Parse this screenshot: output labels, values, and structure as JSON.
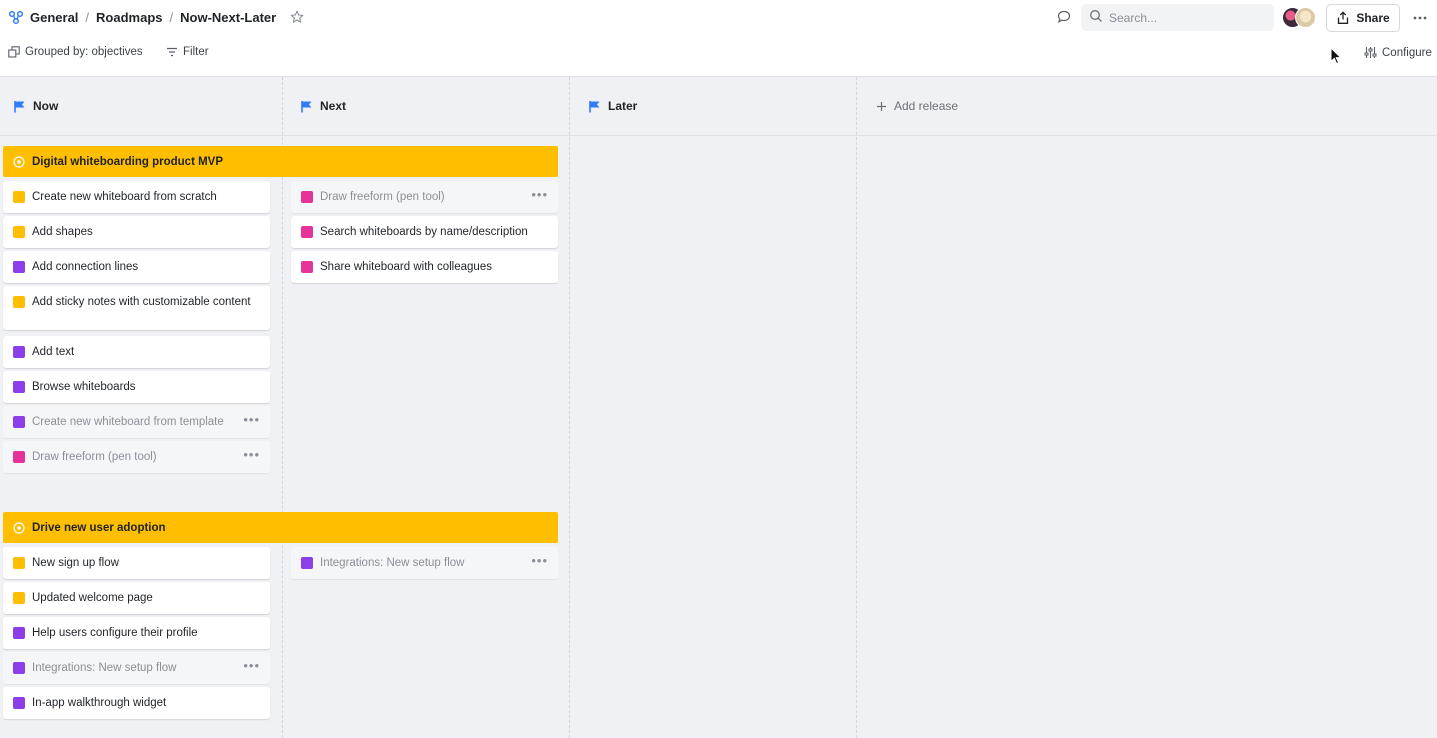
{
  "breadcrumb": [
    "General",
    "Roadmaps",
    "Now-Next-Later"
  ],
  "search": {
    "placeholder": "Search..."
  },
  "share_label": "Share",
  "toolbar": {
    "grouped_by": "Grouped by: objectives",
    "filter": "Filter",
    "configure": "Configure"
  },
  "columns": {
    "now": "Now",
    "next": "Next",
    "later": "Later",
    "add_release": "Add release"
  },
  "colors": {
    "yellow": "#FFBF00",
    "purple": "#8C3FE8",
    "pink": "#E6339A",
    "flag_blue": "#2F7CF6"
  },
  "objectives": [
    {
      "title": "Digital whiteboarding product MVP",
      "now": [
        {
          "label": "Create new whiteboard from scratch",
          "color": "yellow"
        },
        {
          "label": "Add shapes",
          "color": "yellow"
        },
        {
          "label": "Add connection lines",
          "color": "purple"
        },
        {
          "label": "Add sticky notes with customizable content",
          "color": "yellow"
        },
        {
          "label": "Add text",
          "color": "purple"
        },
        {
          "label": "Browse whiteboards",
          "color": "purple"
        },
        {
          "label": "Create new whiteboard from template",
          "color": "purple"
        },
        {
          "label": "Draw freeform (pen tool)",
          "color": "pink"
        }
      ],
      "next": [
        {
          "label": "Draw freeform (pen tool)",
          "color": "pink"
        },
        {
          "label": "Search whiteboards by name/description",
          "color": "pink"
        },
        {
          "label": "Share whiteboard with colleagues",
          "color": "pink"
        }
      ]
    },
    {
      "title": "Drive new user adoption",
      "now": [
        {
          "label": "New sign up flow",
          "color": "yellow"
        },
        {
          "label": "Updated welcome page",
          "color": "yellow"
        },
        {
          "label": "Help users configure their profile",
          "color": "purple"
        },
        {
          "label": "Integrations: New setup flow",
          "color": "purple"
        },
        {
          "label": "In-app walkthrough widget",
          "color": "purple"
        }
      ],
      "next": [
        {
          "label": "Integrations: New setup flow",
          "color": "purple"
        }
      ]
    }
  ]
}
